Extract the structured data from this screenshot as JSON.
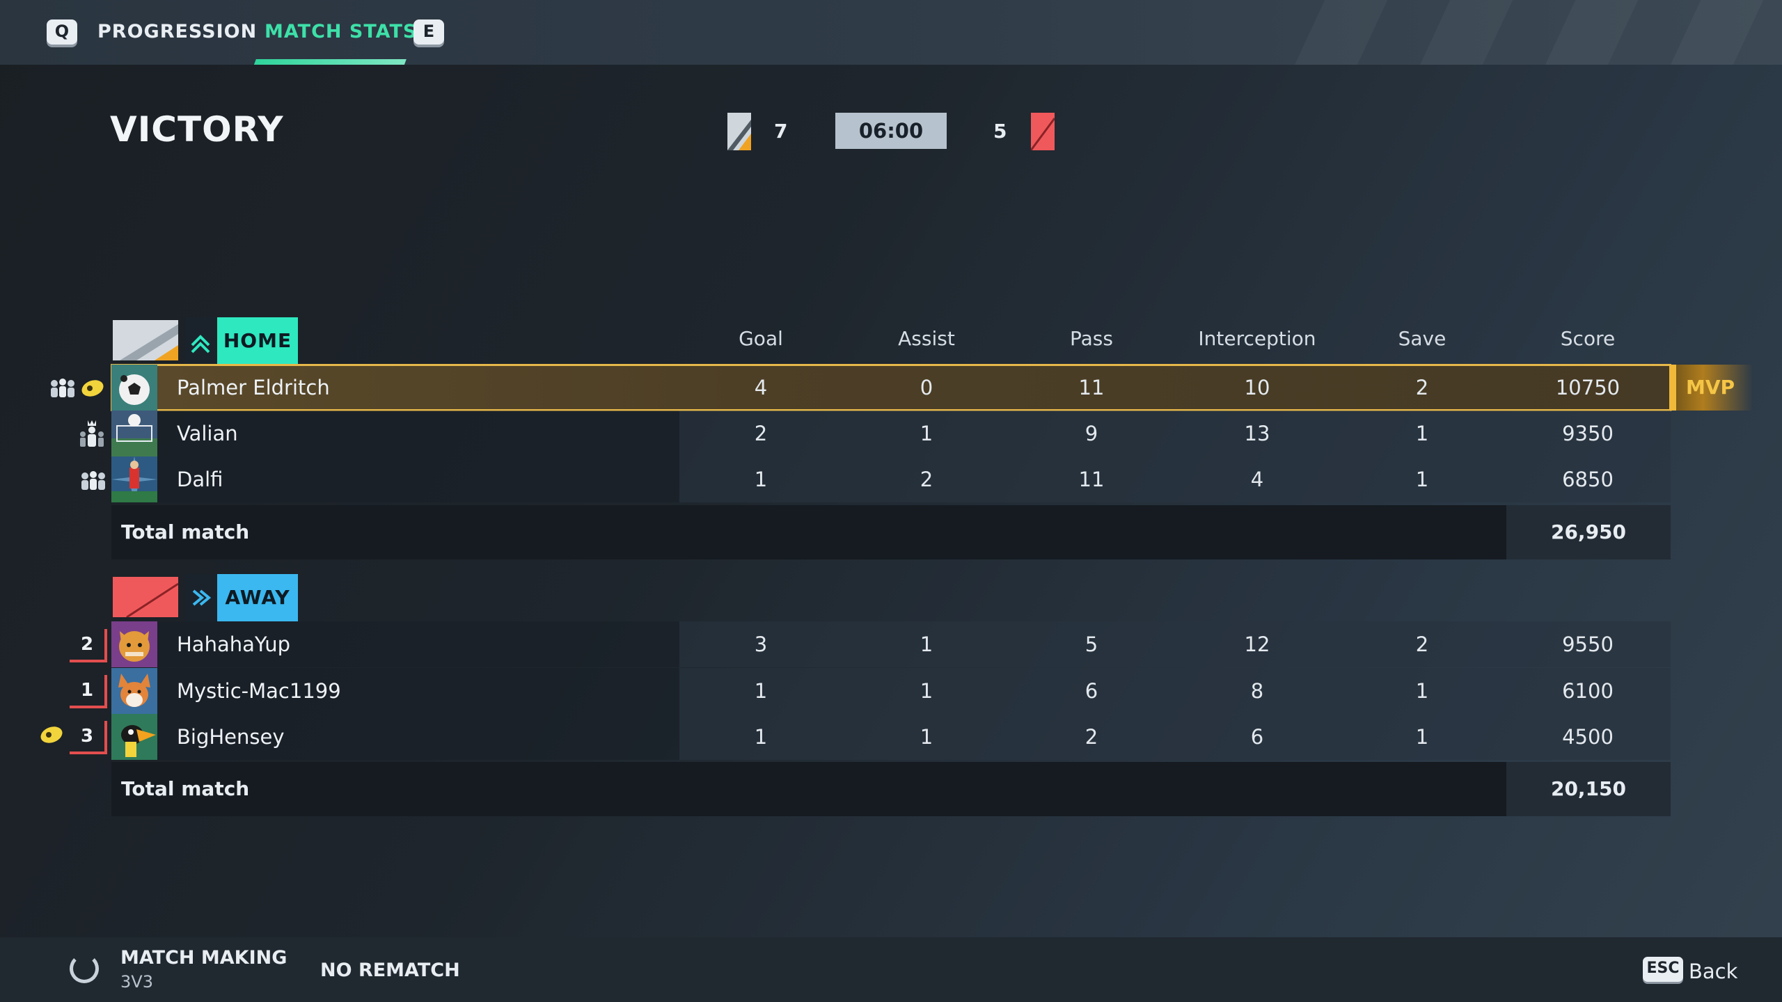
{
  "tabs": {
    "prev_key": "Q",
    "next_key": "E",
    "items": [
      {
        "label": "PROGRESSION",
        "active": false
      },
      {
        "label": "MATCH STATS",
        "active": true
      }
    ]
  },
  "result": {
    "title": "VICTORY",
    "home_score": "7",
    "away_score": "5",
    "time": "06:00"
  },
  "columns": [
    "Goal",
    "Assist",
    "Pass",
    "Interception",
    "Save",
    "Score"
  ],
  "home": {
    "label": "HOME",
    "color": "#2ee8c0",
    "players": [
      {
        "name": "Palmer Eldritch",
        "goal": "4",
        "assist": "0",
        "pass": "11",
        "interception": "10",
        "save": "2",
        "score": "10750",
        "mvp": true
      },
      {
        "name": "Valian",
        "goal": "2",
        "assist": "1",
        "pass": "9",
        "interception": "13",
        "save": "1",
        "score": "9350"
      },
      {
        "name": "Dalfi",
        "goal": "1",
        "assist": "2",
        "pass": "11",
        "interception": "4",
        "save": "1",
        "score": "6850"
      }
    ],
    "total_label": "Total match",
    "total": "26,950"
  },
  "away": {
    "label": "AWAY",
    "color": "#3bb8f0",
    "players": [
      {
        "rank": "2",
        "name": "HahahaYup",
        "goal": "3",
        "assist": "1",
        "pass": "5",
        "interception": "12",
        "save": "2",
        "score": "9550"
      },
      {
        "rank": "1",
        "name": "Mystic-Mac1199",
        "goal": "1",
        "assist": "1",
        "pass": "6",
        "interception": "8",
        "save": "1",
        "score": "6100"
      },
      {
        "rank": "3",
        "name": "BigHensey",
        "goal": "1",
        "assist": "1",
        "pass": "2",
        "interception": "6",
        "save": "1",
        "score": "4500"
      }
    ],
    "total_label": "Total match",
    "total": "20,150"
  },
  "mvp_label": "MVP",
  "footer": {
    "matchmaking_title": "MATCH MAKING",
    "matchmaking_mode": "3V3",
    "no_rematch": "NO REMATCH",
    "esc_key": "ESC",
    "back": "Back"
  },
  "colors": {
    "accent_green": "#2fd49b",
    "mvp_gold": "#e6b84a",
    "away_red": "#e34e4e"
  }
}
